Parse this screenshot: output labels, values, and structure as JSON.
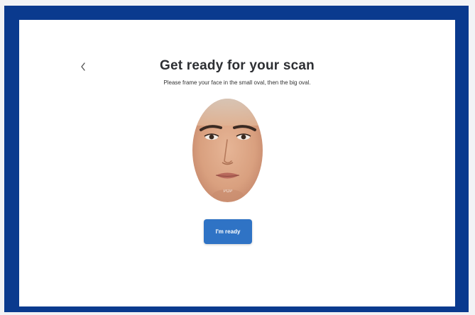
{
  "header": {
    "back_icon": "chevron-left-icon",
    "title": "Get ready for your scan",
    "subtitle": "Please frame your face in the small oval, then the big oval."
  },
  "actions": {
    "ready_label": "I'm ready"
  },
  "colors": {
    "frame": "#0a3a8e",
    "screen_background": "#ffffff",
    "button_primary": "#2f73c5",
    "title_text": "#2d2f33"
  }
}
